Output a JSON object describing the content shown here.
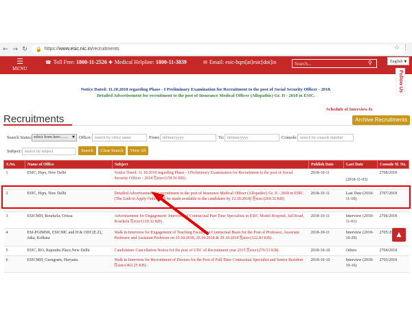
{
  "browser": {
    "back_icon": "arrow-left-icon",
    "forward_icon": "arrow-right-icon",
    "reload_icon": "reload-icon",
    "protocol": "https://",
    "host": "www.esic.nic.in",
    "path": "/recruitments"
  },
  "header": {
    "menu_label": "MENU",
    "toll_free_label": "Toll Free:",
    "toll_free_number": "1800-11-2526",
    "helpline_label": "Medical Helpline:",
    "helpline_number": "1800-11-3839",
    "email": "Email: esic-hqrs[at]esic[dot]in",
    "search_placeholder": "Search...",
    "language": "English",
    "follow_us": "Follow Us"
  },
  "notices": {
    "line1": "Notice Dated: 11.10.2018 regarding Phase - I Preliminary Examination for Recruitment to the post of Social Security Officer - 2018.",
    "line2": "Detailed Advertisement for recruitment to the post of Insurance Medical Officer (Allopathic) Gr. II - 2018 in ESIC.",
    "schedule": "Schedule of Interview fo"
  },
  "page": {
    "title": "Recruitments",
    "archive_button": "Archive Recruitments"
  },
  "filters": {
    "states_label": "Search States:",
    "states_value": "select from here.......",
    "office_label": "Office:",
    "office_placeholder": "search by office name",
    "from_label": "From:",
    "from_placeholder": "dd/mm/yyyy",
    "to_label": "To:",
    "to_placeholder": "dd/mm/yyyy",
    "console_label": "Console:",
    "console_placeholder": "search by console number",
    "subject_label": "Subject:",
    "subject_placeholder": "search by subject",
    "search_button": "Search",
    "clear_button": "Clear Search",
    "view_all_button": "View All"
  },
  "table": {
    "headers": [
      "S.No.",
      "Name of Office",
      "Subject",
      "Publish Date",
      "Last Date",
      "Console Sl. No."
    ],
    "rows": [
      {
        "sno": "1",
        "office": "ESIC, Hqrs, New Delhi",
        "subject": "Notice Dated: 11.10.2018 regarding Phase - I Preliminary Examination for Recruitment to the post of Social Security Officer - 2018",
        "size": "size:(158.56 KB) .",
        "publish": "2018-10-11",
        "last": "(2018-11-03)",
        "console": "2708/2018"
      },
      {
        "sno": "2",
        "office": "ESIC, Hqrs, New Delhi",
        "subject": "Detailed Advertisement for recruitment to the post of Insurance Medical Officer (Allopathic) Gr. II - 2018 in ESIC. (The Link to Apply Online will be made available to the candidates by 12.10.2018)",
        "size": "size:(269.32 KB)",
        "publish": "2018-10-11",
        "last": "Last Date (2018-11-10)",
        "console": "2707/2018"
      },
      {
        "sno": "3",
        "office": "ESICMH, Rourkela, Orissa",
        "subject": "Advertisement for Engagement/ Interview of Contractual Part Time Specialists in ESIC Model Hospital, Jail Road, Rourkela",
        "size": "size:(110.32 KB) .",
        "publish": "2018-10-11",
        "last": "Interview (2018-11-01)",
        "console": "2706/2018"
      },
      {
        "sno": "4",
        "office": "ESI-PGIMSR, ESICMC and H & ODC(E.Z), Joka, Kolkata",
        "subject": "Walk in Interview for Engagement of Teaching Faculty on Contractual Basis for the Post of Professor, Associate Professor and Assistant Professor on 25.10.2018, 26.10.2018 & 29.10.2018",
        "size": "size:(122.83 KB) .",
        "publish": "2018-10-11",
        "last": "Interview (2018-10-29)",
        "console": "2705/2018"
      },
      {
        "sno": "5",
        "office": "ESIC, RO, Rajendra Place,New Delhi",
        "subject": "Candidature Cancellation Notice for the post of UDC of Recruitment year 2015",
        "size": "size:(270.53 KB) .",
        "publish": "2018-10-10",
        "last": "Others",
        "console": "2704/2018"
      },
      {
        "sno": "6",
        "office": "ESICMH, Gurugram, Haryana",
        "subject": "Walk in Interview for Recruitment of Doctors for the Post of Full Time Contractual Specialist and Senior Resident",
        "size": "size:(462.25 KB) .",
        "publish": "2018-10-10",
        "last": "Interview (2018-10-16)",
        "console": "2703/2018"
      }
    ]
  },
  "colors": {
    "brand_red": "#c62828",
    "gold": "#c9961a",
    "notice_blue": "#1e3a8a",
    "notice_green": "#2e7d32",
    "annotation_red": "#e00000"
  }
}
